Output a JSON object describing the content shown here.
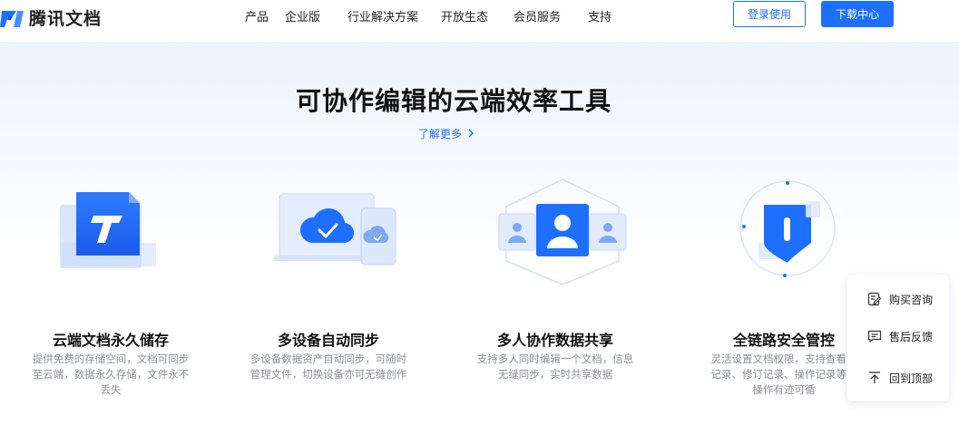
{
  "header": {
    "logo_text": "腾讯文档",
    "nav": [
      "产品",
      "企业版",
      "行业解决方案",
      "开放生态",
      "会员服务",
      "支持"
    ],
    "login_label": "登录使用",
    "download_label": "下载中心"
  },
  "hero": {
    "title": "可协作编辑的云端效率工具",
    "link": "了解更多"
  },
  "features": [
    {
      "title": "云端文档永久储存",
      "desc": [
        "提供免费的存储空间，文档可同步",
        "至云端，数据永久存储，文件永不",
        "丢失"
      ],
      "icon": "document-upload-icon"
    },
    {
      "title": "多设备自动同步",
      "desc": [
        "多设备数据资产自动同步，可随时",
        "管理文件，切换设备亦可无缝创作"
      ],
      "icon": "cloud-sync-icon"
    },
    {
      "title": "多人协作数据共享",
      "desc": [
        "支持多人同时编辑一个文档，信息",
        "无缝同步，实时共享数据"
      ],
      "icon": "collaboration-icon"
    },
    {
      "title": "全链路安全管控",
      "desc": [
        "灵活设置文档权限，支持查看访",
        "记录、修订记录、操作记录等，",
        "操作有迹可循"
      ],
      "icon": "security-shield-icon"
    }
  ],
  "float_panel": {
    "items": [
      {
        "label": "购买咨询",
        "icon": "edit-note-icon"
      },
      {
        "label": "售后反馈",
        "icon": "chat-icon"
      },
      {
        "label": "回到顶部",
        "icon": "arrow-top-icon"
      }
    ]
  },
  "colors": {
    "brand": "#1e6fff",
    "text": "#1f1f1f",
    "muted": "#8a8f99"
  }
}
